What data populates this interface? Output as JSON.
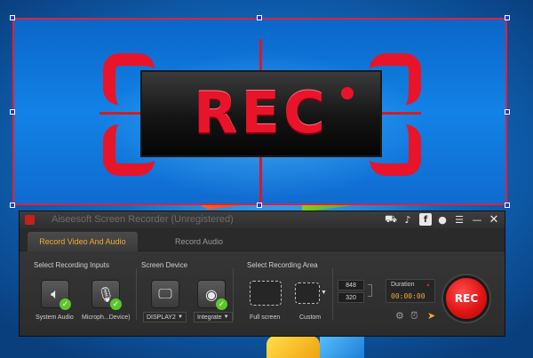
{
  "capture_overlay": {
    "logo_text": "REC"
  },
  "recorder": {
    "title": "Aiseesoft Screen Recorder (Unregistered)",
    "titlebar_icons": [
      "cart-icon",
      "microphone-icon",
      "facebook-icon",
      "chat-icon",
      "menu-icon",
      "minimize-icon",
      "close-icon"
    ],
    "tabs": [
      {
        "label": "Record Video And Audio",
        "active": true
      },
      {
        "label": "Record Audio",
        "active": false
      }
    ],
    "sections": {
      "inputs_label": "Select Recording Inputs",
      "screen_label": "Screen Device",
      "area_label": "Select Recording Area"
    },
    "inputs": [
      {
        "label": "System Audio",
        "checked": true,
        "icon": "speaker-icon"
      },
      {
        "label": "Microph...Device)",
        "checked": true,
        "icon": "microphone-icon"
      }
    ],
    "screen_device": {
      "display": {
        "value": "DISPLAY2",
        "icon": "monitor-icon"
      },
      "camera": {
        "value": "Integrate",
        "icon": "webcam-icon",
        "checked": true
      }
    },
    "area": {
      "full_screen_label": "Full screen",
      "custom_label": "Custom",
      "width": "848",
      "height": "320"
    },
    "duration": {
      "label": "Duration",
      "value": "00:00:00"
    },
    "record_button_label": "REC",
    "colors": {
      "accent_orange": "#f0a93a",
      "record_red": "#e01414",
      "check_green": "#5cc72a",
      "selection_border": "#e2203a"
    }
  }
}
